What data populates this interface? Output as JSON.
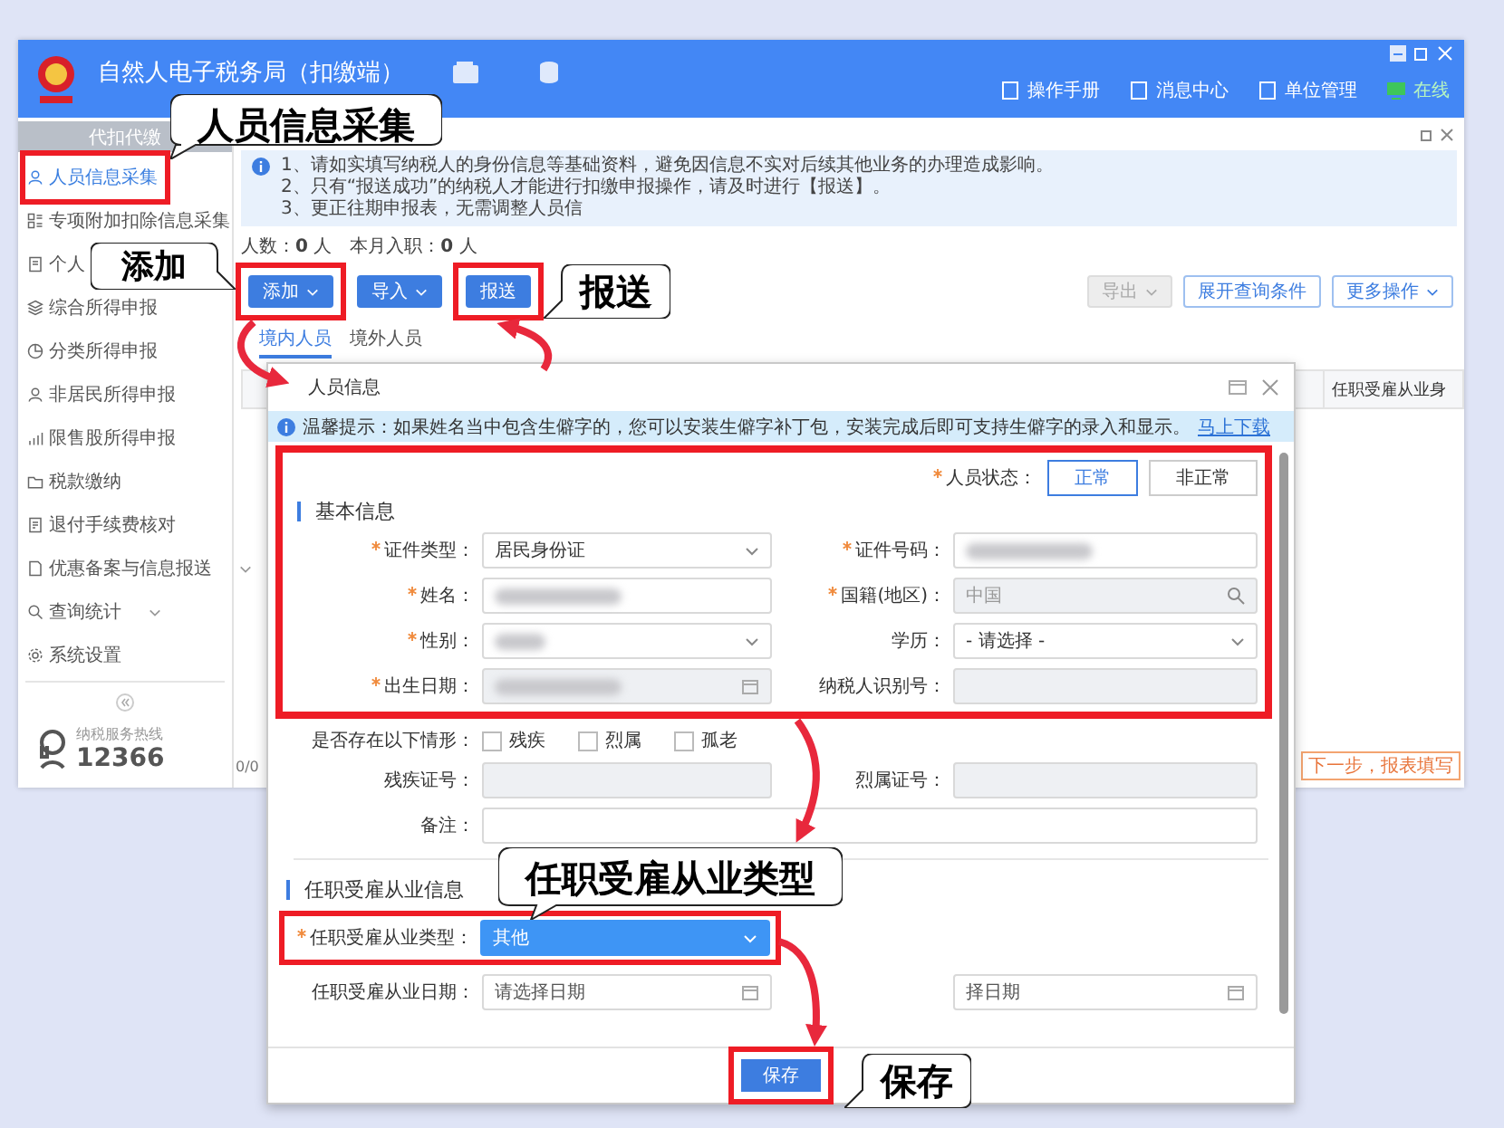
{
  "app": {
    "title": "自然人电子税务局（扣缴端）",
    "header_links": [
      {
        "label": "操作手册",
        "online": false
      },
      {
        "label": "消息中心",
        "online": false
      },
      {
        "label": "单位管理",
        "online": false
      },
      {
        "label": "在线",
        "online": true
      }
    ]
  },
  "sidebar": {
    "heading": "代扣代缴",
    "items": [
      {
        "label": "人员信息采集",
        "selected": true,
        "has_submenu": false
      },
      {
        "label": "专项附加扣除信息采集",
        "selected": false,
        "has_submenu": false
      },
      {
        "label": "个人",
        "selected": false,
        "has_submenu": false
      },
      {
        "label": "综合所得申报",
        "selected": false,
        "has_submenu": false
      },
      {
        "label": "分类所得申报",
        "selected": false,
        "has_submenu": false
      },
      {
        "label": "非居民所得申报",
        "selected": false,
        "has_submenu": false
      },
      {
        "label": "限售股所得申报",
        "selected": false,
        "has_submenu": false
      },
      {
        "label": "税款缴纳",
        "selected": false,
        "has_submenu": false
      },
      {
        "label": "退付手续费核对",
        "selected": false,
        "has_submenu": false
      },
      {
        "label": "优惠备案与信息报送",
        "selected": false,
        "has_submenu": true
      },
      {
        "label": "查询统计",
        "selected": false,
        "has_submenu": true
      },
      {
        "label": "系统设置",
        "selected": false,
        "has_submenu": false
      }
    ],
    "hotline_label": "纳税服务热线",
    "hotline": "12366"
  },
  "notice": [
    "1、请如实填写纳税人的身份信息等基础资料，避免因信息不实对后续其他业务的办理造成影响。",
    "2、只有“报送成功”的纳税人才能进行扣缴申报操作，请及时进行【报送】。",
    "3、更正往期申报表，无需调整人员信"
  ],
  "stats": [
    "人数：**0** 人",
    "本月入职：**0** 人"
  ],
  "toolbar": {
    "left": [
      {
        "label": "添加",
        "kind": "primary",
        "dropdown": true
      },
      {
        "label": "导入",
        "kind": "primary",
        "dropdown": true
      },
      {
        "label": "报送",
        "kind": "primary",
        "dropdown": false
      }
    ],
    "right": [
      {
        "label": "导出",
        "kind": "disabled",
        "dropdown": true
      },
      {
        "label": "展开查询条件",
        "kind": "outline",
        "dropdown": false
      },
      {
        "label": "更多操作",
        "kind": "outline",
        "dropdown": true
      }
    ]
  },
  "tabs": [
    {
      "label": "境内人员",
      "selected": true
    },
    {
      "label": "境外人员",
      "selected": false
    }
  ],
  "table": {
    "columns": [
      "任职受雇从业身"
    ]
  },
  "pagination": "0/0",
  "next_button": "下一步，报表填写",
  "dialog": {
    "title": "人员信息",
    "notice": {
      "text": "温馨提示：如果姓名当中包含生僻字的，您可以安装生僻字补丁包，安装完成后即可支持生僻字的录入和显示。",
      "link": "马上下载"
    },
    "status": {
      "label": "人员状态：",
      "required": true,
      "options": [
        {
          "label": "正常",
          "selected": true
        },
        {
          "label": "非正常",
          "selected": false
        }
      ]
    },
    "basic": {
      "title": "基本信息",
      "fields": [
        {
          "label": "证件类型：",
          "required": true,
          "kind": "select",
          "value": "居民身份证",
          "disabled": false,
          "redacted": false
        },
        {
          "label": "证件号码：",
          "required": true,
          "kind": "text",
          "disabled": false,
          "redacted": true
        },
        {
          "label": "姓名：",
          "required": true,
          "kind": "text",
          "disabled": false,
          "redacted": true
        },
        {
          "label": "国籍(地区)：",
          "required": true,
          "kind": "search",
          "value": "中国",
          "disabled": true,
          "redacted": false
        },
        {
          "label": "性别：",
          "required": true,
          "kind": "select",
          "disabled": false,
          "redacted": true
        },
        {
          "label": "学历：",
          "required": false,
          "kind": "select",
          "value": "- 请选择 -",
          "disabled": false,
          "redacted": false
        },
        {
          "label": "出生日期：",
          "required": true,
          "kind": "date",
          "disabled": true,
          "redacted": true
        },
        {
          "label": "纳税人识别号：",
          "required": false,
          "kind": "text",
          "disabled": true,
          "redacted": false
        }
      ]
    },
    "situations": {
      "label": "是否存在以下情形：",
      "options": [
        {
          "label": "残疾",
          "checked": false
        },
        {
          "label": "烈属",
          "checked": false
        },
        {
          "label": "孤老",
          "checked": false
        }
      ]
    },
    "cert_fields": [
      {
        "label": "残疾证号：",
        "disabled": true
      },
      {
        "label": "烈属证号：",
        "disabled": true
      }
    ],
    "remark": {
      "label": "备注："
    },
    "employment": {
      "title": "任职受雇从业信息",
      "type_field": {
        "label": "任职受雇从业类型：",
        "required": true,
        "value": "其他",
        "highlighted": true
      },
      "date_field": {
        "label": "任职受雇从业日期：",
        "placeholder": "请选择日期"
      },
      "partial_date": {
        "placeholder": "择日期"
      }
    },
    "save": "保存"
  },
  "callouts": [
    "人员信息采集",
    "添加",
    "报送",
    "任职受雇从业类型",
    "保存"
  ]
}
